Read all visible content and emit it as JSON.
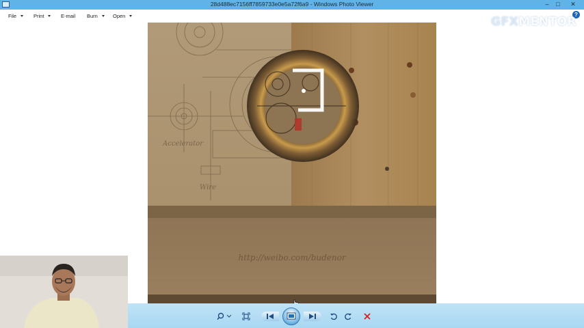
{
  "window": {
    "title": "28d488ec7156ff7859733e0e5a72f6a9 - Windows Photo Viewer",
    "minimize_glyph": "–",
    "maximize_glyph": "□",
    "close_glyph": "✕"
  },
  "menu": {
    "items": [
      {
        "label": "File",
        "has_dropdown": true
      },
      {
        "label": "Print",
        "has_dropdown": true
      },
      {
        "label": "E-mail",
        "has_dropdown": false
      },
      {
        "label": "Burn",
        "has_dropdown": true
      },
      {
        "label": "Open",
        "has_dropdown": true
      }
    ],
    "help_glyph": "?"
  },
  "watermark": {
    "prefix": "GFX",
    "suffix": "MENTOR"
  },
  "photo": {
    "caption": "http://weibo.com/budenor",
    "sketch_labels": [
      "Accelerator",
      "Wire"
    ]
  },
  "toolbar": {
    "buttons": [
      "zoom-icon",
      "fit-actual-size-icon",
      "previous-icon",
      "slideshow-icon",
      "next-icon",
      "rotate-counterclockwise-icon",
      "rotate-clockwise-icon",
      "delete-icon"
    ]
  },
  "colors": {
    "titlebar": "#5fb3e6",
    "toolbar": "#b4ddf4",
    "delete": "#d42020",
    "wood": "#a9875c"
  }
}
